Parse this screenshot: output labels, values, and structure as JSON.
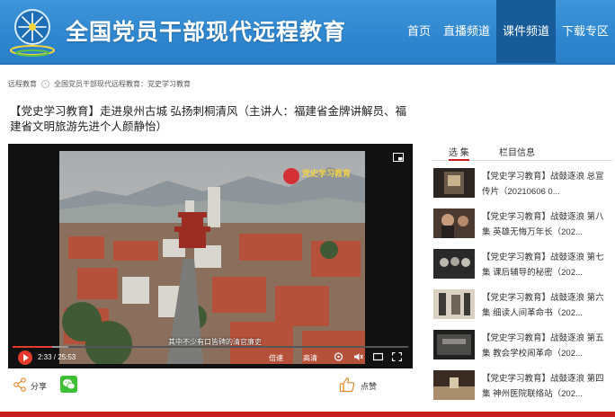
{
  "header": {
    "site_title": "全国党员干部现代远程教育",
    "nav": [
      {
        "label": "首页",
        "active": false
      },
      {
        "label": "直播频道",
        "active": false
      },
      {
        "label": "课件频道",
        "active": true
      },
      {
        "label": "下载专区",
        "active": false
      }
    ],
    "brand_color": "#2e86cf",
    "active_nav_color": "#185b99"
  },
  "breadcrumb": [
    "远程教育",
    "全国党员干部现代远程教育：党史学习教育"
  ],
  "page_title": "【党史学习教育】走进泉州古城 弘扬刺桐清风（主讲人：福建省金牌讲解员、福建省文明旅游先进个人颜静怡）",
  "player": {
    "watermark": "党史学习教育",
    "subtitle": "其中不少有口皆碑的清官廉吏",
    "time": "2:33 / 25:53",
    "progress": 0.099,
    "buffered": 0.14,
    "quality_label": "倍速",
    "definition_label": "高清",
    "accent": "#e43b2c"
  },
  "share": {
    "share_label": "分享",
    "like_label": "点赞",
    "wechat_icon": "wechat-icon"
  },
  "sidebar": {
    "tabs": [
      {
        "label": "选 集",
        "active": true
      },
      {
        "label": "栏目信息",
        "active": false
      }
    ],
    "items": [
      {
        "title": "【党史学习教育】战鼓逐浪 总宣传片（20210606 0..."
      },
      {
        "title": "【党史学习教育】战鼓逐浪 第八集 英雄无悔万年长（202..."
      },
      {
        "title": "【党史学习教育】战鼓逐浪 第七集 课后辅导的秘密（202..."
      },
      {
        "title": "【党史学习教育】战鼓逐浪 第六集 细读人间革命书（202..."
      },
      {
        "title": "【党史学习教育】战鼓逐浪 第五集 教会学校闹革命（202..."
      },
      {
        "title": "【党史学习教育】战鼓逐浪 第四集 神州医院联络站（202..."
      }
    ]
  },
  "footer_accent": "#c71d1d"
}
